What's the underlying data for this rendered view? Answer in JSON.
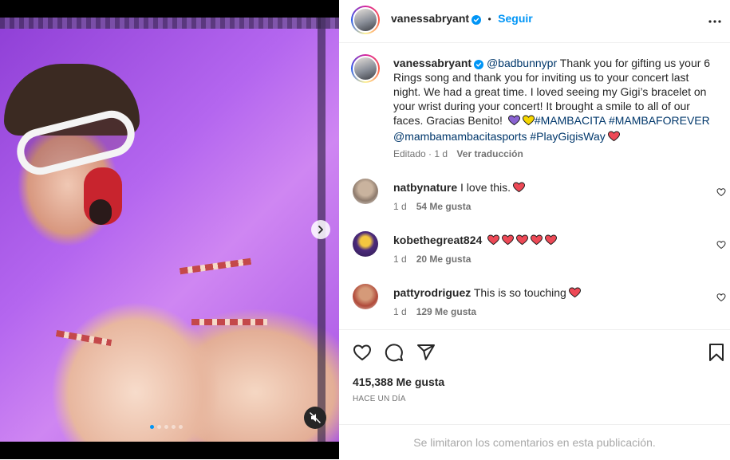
{
  "post_author": {
    "username": "vanessabryant",
    "verified": true,
    "separator": "•",
    "follow_label": "Seguir"
  },
  "caption": {
    "username": "vanessabryant",
    "mention_1": "@badbunnypr",
    "text_1": " Thank you for gifting us your 6 Rings song and thank you for inviting us to your concert last night. We had a great time. I loved seeing my Gigi’s bracelet on your wrist during your concert! It brought a smile to all of our faces. Gracias Benito! ",
    "hashtag_1": "#MAMBACITA",
    "hashtag_2": "#MAMBAFOREVER",
    "mention_2": "@mambamambacitasports",
    "hashtag_3": "#PlayGigisWay"
  },
  "caption_meta": {
    "edited": "Editado",
    "dot": "·",
    "time": "1 d",
    "see_translation": "Ver traducción"
  },
  "comments": [
    {
      "username": "natbynature",
      "text": "I love this.",
      "hearts": 1,
      "time": "1 d",
      "likes": "54 Me gusta"
    },
    {
      "username": "kobethegreat824",
      "text": "",
      "hearts": 5,
      "time": "1 d",
      "likes": "20 Me gusta"
    },
    {
      "username": "pattyrodriguez",
      "text": "This is so touching",
      "hearts": 1,
      "time": "1 d",
      "likes": "129 Me gusta"
    }
  ],
  "footer": {
    "likes_count": "415,388 Me gusta",
    "timestamp": "HACE UN DÍA",
    "comments_disabled": "Se limitaron los comentarios en esta publicación."
  },
  "carousel": {
    "total_slides": 5,
    "active_index": 0
  },
  "icons": {
    "more": "more-options-icon",
    "like": "heart-icon",
    "comment": "comment-icon",
    "share": "share-icon",
    "save": "bookmark-icon",
    "next": "chevron-right-icon",
    "mute": "speaker-muted-icon"
  },
  "colors": {
    "accent": "#0095f6",
    "link": "#00376b",
    "heart_red": "#ed4956",
    "heart_purple": "#8a63d2",
    "heart_yellow": "#f5d600"
  }
}
